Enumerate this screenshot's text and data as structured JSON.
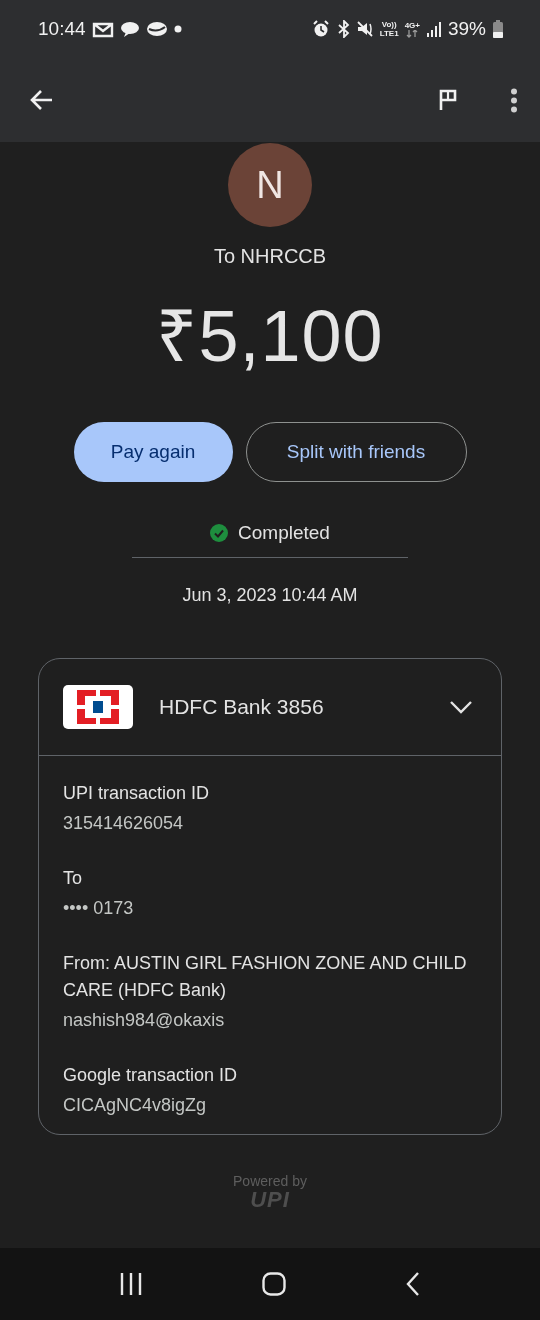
{
  "status_bar": {
    "time": "10:44",
    "network_top": "Vo))",
    "network_bottom": "LTE1",
    "data_type": "4G+",
    "battery": "39%"
  },
  "payee": {
    "initial": "N",
    "name": "To NHRCCB"
  },
  "amount": "₹5,100",
  "actions": [
    {
      "label": "Pay again",
      "kind": "filled"
    },
    {
      "label": "Split with friends",
      "kind": "outlined"
    }
  ],
  "status": {
    "label": "Completed",
    "kind": "success"
  },
  "date": "Jun 3, 2023 10:44 AM",
  "account": {
    "name": "HDFC Bank 3856",
    "expanded": true,
    "details": [
      {
        "label": "UPI transaction ID",
        "value": "315414626054"
      },
      {
        "label": "To",
        "value": "•••• 0173"
      },
      {
        "label": "From: AUSTIN GIRL FASHION ZONE AND CHILD CARE (HDFC Bank)",
        "value": "nashish984@okaxis"
      },
      {
        "label": "Google transaction ID",
        "value": "CICAgNC4v8igZg"
      }
    ]
  },
  "footer": {
    "powered_by": "Powered by",
    "logo": "UPI"
  }
}
